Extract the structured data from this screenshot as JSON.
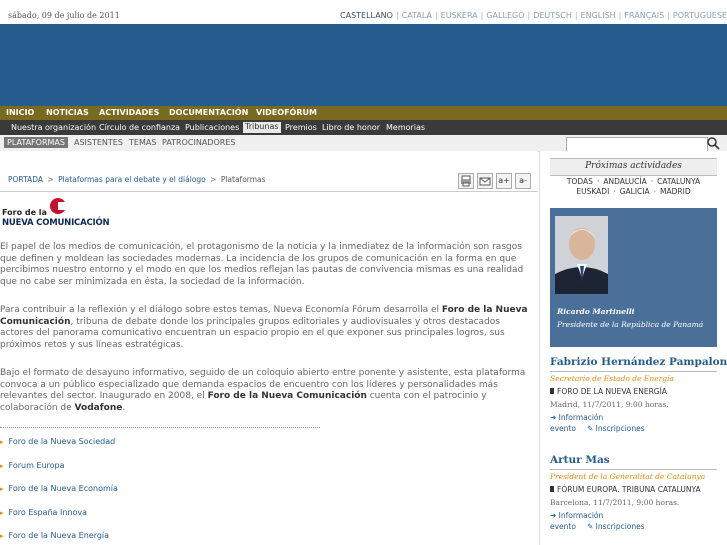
{
  "header": {
    "date": "sábado, 09 de julio de 2011",
    "languages": [
      "CASTELLANO",
      "CATALÀ",
      "EUSKERA",
      "GALLEGO",
      "DEUTSCH",
      "ENGLISH",
      "FRANÇAIS",
      "PORTUGUESE"
    ],
    "active_language": "CASTELLANO"
  },
  "nav_main": [
    "INICIO",
    "NOTICIAS",
    "ACTIVIDADES",
    "DOCUMENTACIÓN",
    "VIDEOFÓRUM"
  ],
  "nav_sub": [
    "Nuestra organización",
    "Círculo de confianza",
    "Publicaciones",
    "Tribunas",
    "Premios",
    "Libro de honor",
    "Memorias"
  ],
  "nav_sub_active": "Tribunas",
  "nav_third": [
    "PLATAFORMAS",
    "ASISTENTES",
    "TEMAS",
    "PATROCINADORES"
  ],
  "search": {
    "placeholder": ""
  },
  "breadcrumb": {
    "home": "PORTADA",
    "parent": "Plataformas para el debate y el diálogo",
    "current": "Plataformas",
    "sep": ">"
  },
  "tools": {
    "font_plus": "a+",
    "font_minus": "a-"
  },
  "logo": {
    "line1": "Foro de la",
    "line2": "NUEVA COMUNICACIÓN"
  },
  "body": {
    "p1": "El papel de los medios de comunicación, el protagonismo de la noticia y la inmediatez de la información son rasgos que definen y moldean las sociedades modernas. La incidencia de los grupos de comunicación en la forma en que percibimos nuestro entorno y el modo en que los medios reflejan las pautas de convivencia mismas es una realidad que no cabe ser minimizada en ésta, la sociedad de la información.",
    "p2a": "Para contribuir a la reflexión y el diálogo sobre estos temas, Nueva Economía Fórum desarrolla el ",
    "p2b": "Foro de la Nueva Comunicación",
    "p2c": ", tribuna de debate donde los principales grupos editoriales y audiovisuales y otros destacados actores del panorama comunicativo encuentran un espacio propio en el que exponer sus principales logros, sus próximos retos y sus líneas estratégicas.",
    "p3a": "Bajo el formato de desayuno informativo, seguido de un coloquio abierto entre ponente y asistente, esta plataforma convoca a un público especializado que demanda espacios de encuentro con los líderes y personalidades más relevantes del sector. Inaugurado en 2008, el ",
    "p3b": "Foro de la Nueva Comunicación",
    "p3c": " cuenta con el patrocinio y colaboración de ",
    "p3d": "Vodafone",
    "p3e": "."
  },
  "forums": [
    "Foro de la Nueva Sociedad",
    "Forum Europa",
    "Foro de la Nueva Economía",
    "Foro España Innova",
    "Foro de la Nueva Energía"
  ],
  "sidebar": {
    "heading": "Próximas actividades",
    "regions_row1": [
      "TODAS",
      "ANDALUCÍA",
      "CATALUNYA"
    ],
    "regions_row2": [
      "EUSKADI",
      "GALICIA",
      "MADRID"
    ],
    "featured": {
      "name": "Ricardo Martinelli",
      "role": "Presidente de la República de Panamá"
    },
    "events": [
      {
        "name": "Fabrizio Hernández Pampaloni",
        "role": "Secretario de Estado de Energía",
        "forum": "FORO DE LA NUEVA ENERGÍA",
        "date": "Madrid, 11/7/2011, 9:00 horas.",
        "info1": "Información",
        "info2": "evento",
        "signup": "Inscripciones"
      },
      {
        "name": "Artur Mas",
        "role": "President de la Generalitat de Catalunya",
        "forum": "FÓRUM EUROPA. TRIBUNA CATALUNYA",
        "date": "Barcelona, 11/7/2011, 9:00 horas.",
        "info1": "Información",
        "info2": "evento",
        "signup": "Inscripciones"
      }
    ]
  },
  "colors": {
    "banner": "#255c8e",
    "nav_main": "#7a6a1e",
    "nav_sub": "#3a3a3a",
    "link": "#255c8e",
    "accent": "#e08c00"
  }
}
